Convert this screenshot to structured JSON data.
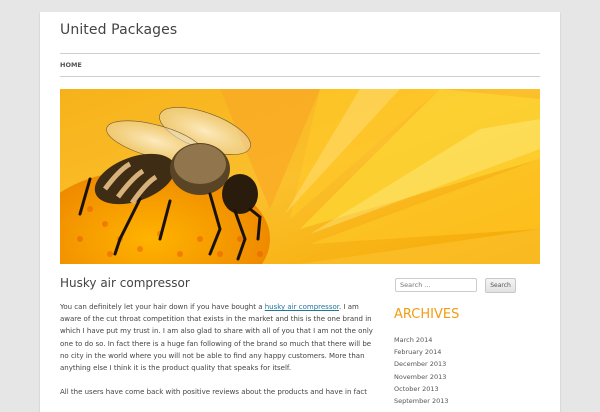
{
  "site": {
    "title": "United Packages"
  },
  "nav": {
    "items": [
      {
        "label": "HOME"
      }
    ]
  },
  "post": {
    "title": "Husky air compressor",
    "paragraphs": [
      {
        "before": "You can definitely let your hair down if you have bought a ",
        "link": "husky air compressor",
        "after": ". I am aware of the cut throat competition that exists in the market and this is the one brand in which I have put my trust in. I am also glad to share with all of you that I am not the only one to do so. In fact there is a huge fan following of the brand so much that there will be no city in the world where you will not be able to find any happy customers. More than anything else I think it is the product quality that speaks for itself."
      },
      {
        "text": "All the users have come back with positive reviews about the products and have in fact"
      }
    ]
  },
  "sidebar": {
    "search": {
      "placeholder": "Search ...",
      "button_label": "Search"
    },
    "archives": {
      "title": "ARCHIVES",
      "items": [
        "March 2014",
        "February 2014",
        "December 2013",
        "November 2013",
        "October 2013",
        "September 2013"
      ]
    }
  },
  "colors": {
    "accent": "#f39c12",
    "link": "#21759b"
  }
}
